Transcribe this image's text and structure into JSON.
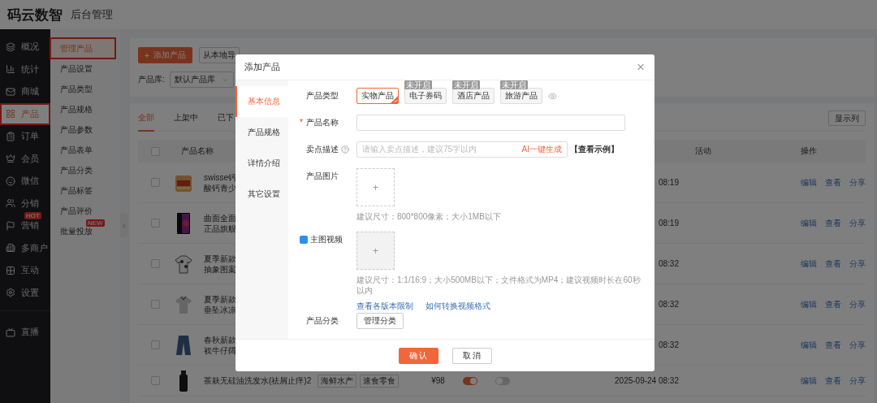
{
  "header": {
    "brand": "码云数智",
    "subtitle": "后台管理"
  },
  "nav_groups": [
    [
      {
        "label": "概况",
        "selected": false,
        "highlighted": false
      },
      {
        "label": "统计",
        "selected": false,
        "highlighted": false
      },
      {
        "label": "商城",
        "selected": false,
        "highlighted": false
      },
      {
        "label": "产品",
        "selected": true,
        "highlighted": true
      },
      {
        "label": "订单",
        "selected": false,
        "highlighted": false
      },
      {
        "label": "会员",
        "selected": false,
        "highlighted": false
      },
      {
        "label": "微信",
        "selected": false,
        "highlighted": false
      },
      {
        "label": "分销",
        "selected": false,
        "highlighted": false
      },
      {
        "label": "营销",
        "selected": false,
        "highlighted": false,
        "badge": "HOT"
      },
      {
        "label": "多商户",
        "selected": false,
        "highlighted": false
      },
      {
        "label": "互动",
        "selected": false,
        "highlighted": false
      },
      {
        "label": "设置",
        "selected": false,
        "highlighted": false
      }
    ],
    [
      {
        "label": "直播",
        "selected": false,
        "highlighted": false
      }
    ]
  ],
  "subnav": [
    {
      "label": "管理产品",
      "selected": true,
      "highlighted": true
    },
    {
      "label": "产品设置",
      "selected": false,
      "highlighted": false
    },
    {
      "label": "产品类型",
      "selected": false,
      "highlighted": false
    },
    {
      "label": "产品规格",
      "selected": false,
      "highlighted": false
    },
    {
      "label": "产品参数",
      "selected": false,
      "highlighted": false
    },
    {
      "label": "产品表单",
      "selected": false,
      "highlighted": false
    },
    {
      "label": "产品分类",
      "selected": false,
      "highlighted": false
    },
    {
      "label": "产品标签",
      "selected": false,
      "highlighted": false
    },
    {
      "label": "产品评价",
      "selected": false,
      "highlighted": false
    },
    {
      "label": "批量投放",
      "selected": false,
      "highlighted": false,
      "badge": "NEW"
    }
  ],
  "collapse_handle": "‹",
  "toolbar": {
    "add_icon": "+",
    "add_button": "添加产品",
    "import_button": "从本地导",
    "library_label": "产品库:",
    "library_value": "默认产品库"
  },
  "tabs": [
    {
      "label": "全部",
      "selected": true
    },
    {
      "label": "上架中",
      "selected": false
    },
    {
      "label": "已下",
      "selected": false
    }
  ],
  "columns_button": "显示列",
  "table": {
    "select_all_checked": false,
    "columns": [
      "产品名称",
      "活动",
      "操作"
    ],
    "rows": [
      {
        "checked": false,
        "name_lines": [
          "swisse钙",
          "酸钙青少"
        ],
        "time": "08:19",
        "actions": [
          "编辑",
          "查看",
          "分享"
        ]
      },
      {
        "checked": false,
        "name_lines": [
          "曲面全面",
          "正品旗舰"
        ],
        "time": "08:19",
        "actions": [
          "编辑",
          "查看",
          "分享"
        ]
      },
      {
        "checked": false,
        "name_lines": [
          "夏季新款",
          "抽象图案"
        ],
        "time": "08:32",
        "actions": [
          "编辑",
          "查看",
          "分享"
        ]
      },
      {
        "checked": false,
        "name_lines": [
          "夏季新款",
          "垂坠冰凉"
        ],
        "time": "08:32",
        "actions": [
          "编辑",
          "查看",
          "分享"
        ]
      },
      {
        "checked": false,
        "name_lines": [
          "春秋新款",
          "衩牛仔阔"
        ],
        "time": "08:32",
        "actions": [
          "编辑",
          "查看",
          "分享"
        ]
      },
      {
        "checked": false,
        "name_lines": [
          "茶麸无硅油洗发水(祛屑止痒)2"
        ],
        "tags": [
          "海鲜水产",
          "速食零食"
        ],
        "price": "¥98",
        "toggles": [
          true,
          false
        ],
        "time": "2025-09-24 08:32",
        "actions": [
          "编辑",
          "查看",
          "分享"
        ]
      }
    ]
  },
  "modal": {
    "title": "添加产品",
    "close": "×",
    "sections": [
      {
        "label": "基本信息",
        "selected": true
      },
      {
        "label": "产品规格",
        "selected": false
      },
      {
        "label": "详情介绍",
        "selected": false
      },
      {
        "label": "其它设置",
        "selected": false
      }
    ],
    "type_label": "产品类型",
    "types": [
      {
        "label": "实物产品",
        "selected": true
      },
      {
        "label": "电子券码",
        "selected": false,
        "badge": "未开启"
      },
      {
        "label": "酒店产品",
        "selected": false,
        "badge": "未开启"
      },
      {
        "label": "旅游产品",
        "selected": false,
        "badge": "未开启"
      }
    ],
    "name_label": "产品名称",
    "required_mark": "*",
    "desc_label": "卖点描述",
    "desc_placeholder": "请输入卖点描述，建议75字以内",
    "ai_button": "AI一键生成",
    "example_link": "【查看示例】",
    "image_label": "产品图片",
    "upload_plus": "+",
    "image_hint": "建议尺寸：800*800像素；大小1MB以下",
    "video_label": "主图视频",
    "video_plus": "+",
    "video_hint": "建议尺寸：1:1/16:9；大小500MB以下；文件格式为MP4；建议视频时长在60秒以内",
    "video_links": [
      "查看各版本限制",
      "如何转换视频格式"
    ],
    "category_label": "产品分类",
    "category_button": "管理分类",
    "confirm": "确 认",
    "cancel": "取 消"
  }
}
